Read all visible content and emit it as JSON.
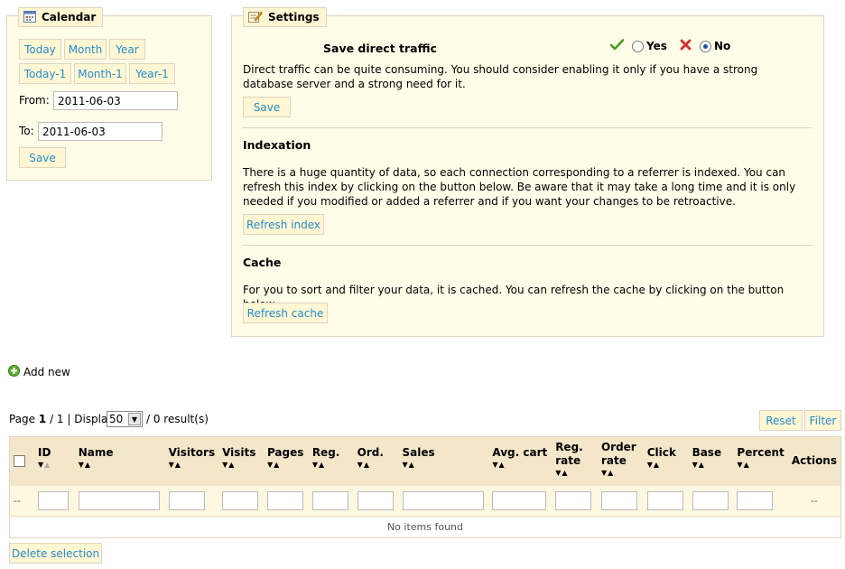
{
  "calendar": {
    "title": "Calendar",
    "buttons": [
      "Today",
      "Month",
      "Year",
      "Today-1",
      "Month-1",
      "Year-1"
    ],
    "from_label": "From:",
    "from_value": "2011-06-03",
    "to_label": "To:",
    "to_value": "2011-06-03",
    "save_label": "Save"
  },
  "settings": {
    "title": "Settings",
    "direct_traffic": {
      "label": "Save direct traffic",
      "yes_label": "Yes",
      "no_label": "No",
      "selected": "No",
      "description": "Direct traffic can be quite consuming. You should consider enabling it only if you have a strong database server and a strong need for it.",
      "save_label": "Save"
    },
    "indexation": {
      "heading": "Indexation",
      "description": "There is a huge quantity of data, so each connection corresponding to a referrer is indexed. You can refresh this index by clicking on the button below. Be aware that it may take a long time and it is only needed if you modified or added a referrer and if you want your changes to be retroactive.",
      "button_label": "Refresh index"
    },
    "cache": {
      "heading": "Cache",
      "description": "For you to sort and filter your data, it is cached. You can refresh the cache by clicking on the button below.",
      "button_label": "Refresh cache"
    }
  },
  "add_new_label": "Add new",
  "pagination": {
    "page_label": "Page",
    "current_page": "1",
    "total_pages": "1",
    "display_label": "Display",
    "display_value": "50",
    "results_text": "/ 0 result(s)"
  },
  "list_actions": {
    "reset_label": "Reset",
    "filter_label": "Filter"
  },
  "table": {
    "columns": [
      {
        "key": "id",
        "label": "ID"
      },
      {
        "key": "name",
        "label": "Name"
      },
      {
        "key": "visitors",
        "label": "Visitors"
      },
      {
        "key": "visits",
        "label": "Visits"
      },
      {
        "key": "pages",
        "label": "Pages"
      },
      {
        "key": "reg",
        "label": "Reg."
      },
      {
        "key": "ord",
        "label": "Ord."
      },
      {
        "key": "sales",
        "label": "Sales"
      },
      {
        "key": "avg_cart",
        "label": "Avg. cart"
      },
      {
        "key": "reg_rate",
        "label": "Reg. rate"
      },
      {
        "key": "order_rate",
        "label": "Order rate"
      },
      {
        "key": "click",
        "label": "Click"
      },
      {
        "key": "base",
        "label": "Base"
      },
      {
        "key": "percent",
        "label": "Percent"
      }
    ],
    "actions_label": "Actions",
    "filter_placeholder_dash": "--",
    "empty_message": "No items found"
  },
  "delete_selection_label": "Delete selection",
  "colors": {
    "link_blue": "#268ccd",
    "panel_bg": "#fffde8",
    "panel_border": "#dfd5c3",
    "header_bg": "#f4e6c9",
    "check_green": "#4a9a1c",
    "cross_red": "#d62b2b"
  }
}
